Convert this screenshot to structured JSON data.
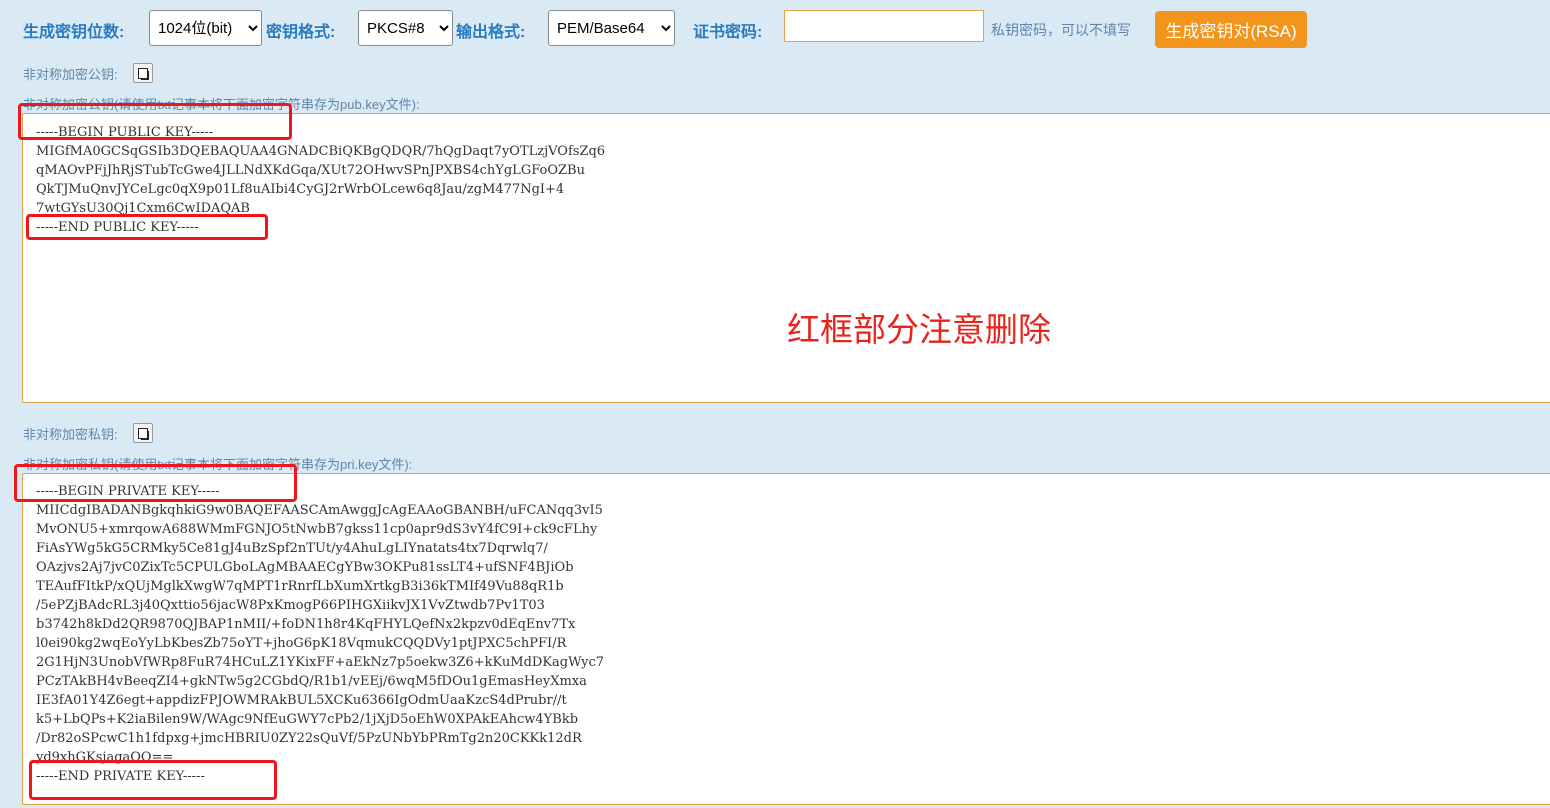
{
  "toolbar": {
    "bits_label": "生成密钥位数:",
    "bits_value": "1024位(bit)",
    "format_label": "密钥格式:",
    "format_value": "PKCS#8",
    "output_label": "输出格式:",
    "output_value": "PEM/Base64",
    "cert_pwd_label": "证书密码:",
    "cert_pwd_value": "",
    "cert_pwd_hint": "私钥密码，可以不填写",
    "generate_button": "生成密钥对(RSA)"
  },
  "public_key": {
    "label": "非对称加密公钥:",
    "save_hint": "非对称加密公钥(请使用txt记事本将下面加密字符串存为pub.key文件):",
    "text": "-----BEGIN PUBLIC KEY-----\nMIGfMA0GCSqGSIb3DQEBAQUAA4GNADCBiQKBgQDQR/7hQgDaqt7yOTLzjVOfsZq6\nqMAOvPFjJhRjSTubTcGwe4JLLNdXKdGqa/XUt72OHwvSPnJPXBS4chYgLGFoOZBu\nQkTJMuQnvJYCeLgc0qX9p01Lf8uAIbi4CyGJ2rWrbOLcew6q8Jau/zgM477NgI+4\n7wtGYsU30Qj1Cxm6CwIDAQAB\n-----END PUBLIC KEY-----"
  },
  "notice": "红框部分注意删除",
  "private_key": {
    "label": "非对称加密私钥:",
    "save_hint": "非对称加密私钥(请使用txt记事本将下面加密字符串存为pri.key文件):",
    "text": "-----BEGIN PRIVATE KEY-----\nMIICdgIBADANBgkqhkiG9w0BAQEFAASCAmAwggJcAgEAAoGBANBH/uFCANqq3vI5\nMvONU5+xmrqowA688WMmFGNJO5tNwbB7gkss11cp0apr9dS3vY4fC9I+ck9cFLhy\nFiAsYWg5kG5CRMky5Ce81gJ4uBzSpf2nTUt/y4AhuLgLIYnatats4tx7Dqrwlq7/\nOAzjvs2Aj7jvC0ZixTc5CPULGboLAgMBAAECgYBw3OKPu81ssLT4+ufSNF4BJiOb\nTEAufFItkP/xQUjMglkXwgW7qMPT1rRnrfLbXumXrtkgB3i36kTMIf49Vu88qR1b\n/5ePZjBAdcRL3j40Qxttio56jacW8PxKmogP66PIHGXiikvJX1VvZtwdb7Pv1T03\nb3742h8kDd2QR9870QJBAP1nMII/+foDN1h8r4KqFHYLQefNx2kpzv0dEqEnv7Tx\nl0ei90kg2wqEoYyLbKbesZb75oYT+jhoG6pK18VqmukCQQDVy1ptJPXC5chPFI/R\n2G1HjN3UnobVfWRp8FuR74HCuLZ1YKixFF+aEkNz7p5oekw3Z6+kKuMdDKagWyc7\nPCzTAkBH4vBeeqZI4+gkNTw5g2CGbdQ/R1b1/vEEj/6wqM5fDOu1gEmasHeyXmxa\nIE3fA01Y4Z6egt+appdizFPJOWMRAkBUL5XCKu6366IgOdmUaaKzcS4dPrubr//t\nk5+LbQPs+K2iaBilen9W/WAgc9NfEuGWY7cPb2/1jXjD5oEhW0XPAkEAhcw4YBkb\n/Dr82oSPcwC1h1fdpxg+jmcHBRIU0ZY22sQuVf/5PzUNbYbPRmTg2n20CKKk12dR\nyd9xhGKsjagaQQ==\n-----END PRIVATE KEY-----"
  }
}
